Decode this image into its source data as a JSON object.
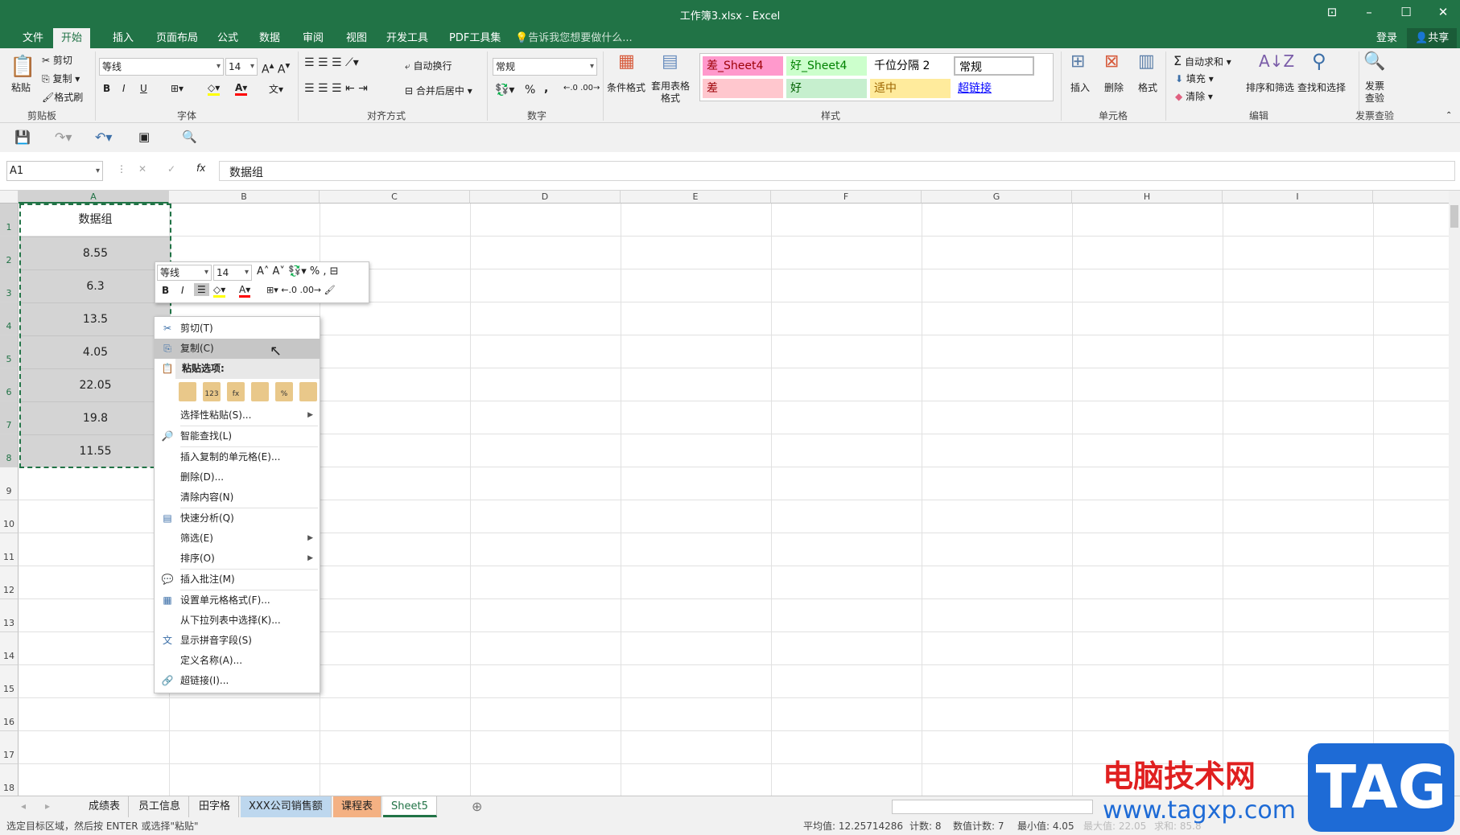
{
  "window": {
    "title": "工作簿3.xlsx - Excel",
    "restore_icon": "ribbon-display-icon"
  },
  "tabs": [
    "文件",
    "开始",
    "插入",
    "页面布局",
    "公式",
    "数据",
    "审阅",
    "视图",
    "开发工具",
    "PDF工具集"
  ],
  "active_tab": "开始",
  "tell_me": "告诉我您想要做什么...",
  "account": {
    "signin": "登录",
    "share": "共享"
  },
  "ribbon": {
    "clipboard": {
      "paste": "粘贴",
      "cut": "剪切",
      "copy": "复制",
      "format_painter": "格式刷",
      "group": "剪贴板"
    },
    "font": {
      "name": "等线",
      "size": "14",
      "bold": "B",
      "italic": "I",
      "underline": "U",
      "group": "字体"
    },
    "alignment": {
      "wrap": "自动换行",
      "merge": "合并后居中",
      "group": "对齐方式"
    },
    "number": {
      "format": "常规",
      "percent": "%",
      "comma": ",",
      "group": "数字"
    },
    "styles": {
      "cond": "条件格式",
      "table": "套用表格格式",
      "cells": [
        {
          "label": "差_Sheet4",
          "bg": "#ff99cc",
          "fg": "#9c0006"
        },
        {
          "label": "好_Sheet4",
          "bg": "#ccffcc",
          "fg": "#008000"
        },
        {
          "label": "千位分隔 2",
          "bg": "#ffffff",
          "fg": "#000000"
        },
        {
          "label": "常规",
          "bg": "#ffffff",
          "fg": "#000000"
        },
        {
          "label": "差",
          "bg": "#ffc7ce",
          "fg": "#9c0006"
        },
        {
          "label": "好",
          "bg": "#c6efce",
          "fg": "#006100"
        },
        {
          "label": "适中",
          "bg": "#ffeb9c",
          "fg": "#9c6500"
        },
        {
          "label": "超链接",
          "bg": "#ffffff",
          "fg": "#0000ff"
        }
      ],
      "group": "样式"
    },
    "cells": {
      "insert": "插入",
      "delete": "删除",
      "format": "格式",
      "group": "单元格"
    },
    "editing": {
      "autosum": "自动求和",
      "fill": "填充",
      "clear": "清除",
      "sort": "排序和筛选",
      "find": "查找和选择",
      "group": "编辑"
    },
    "invoice": {
      "check": "发票查验",
      "group": "发票查验"
    }
  },
  "formula_bar": {
    "name_box": "A1",
    "fx": "fx",
    "content": "数据组"
  },
  "columns": [
    "A",
    "B",
    "C",
    "D",
    "E",
    "F",
    "G",
    "H",
    "I"
  ],
  "rows": [
    "1",
    "2",
    "3",
    "4",
    "5",
    "6",
    "7",
    "8",
    "9",
    "10",
    "11",
    "12",
    "13",
    "14",
    "15",
    "16",
    "17",
    "18"
  ],
  "column_a": [
    "数据组",
    "8.55",
    "6.3",
    "13.5",
    "4.05",
    "22.05",
    "19.8",
    "11.55"
  ],
  "mini_toolbar": {
    "font": "等线",
    "size": "14"
  },
  "context_menu": [
    {
      "label": "剪切(T)",
      "icon": "scissors-icon"
    },
    {
      "label": "复制(C)",
      "icon": "copy-icon",
      "highlight": true
    },
    {
      "label": "粘贴选项:",
      "icon": "paste-icon",
      "header": true
    },
    {
      "label": "选择性粘贴(S)...",
      "submenu": true,
      "sep": true
    },
    {
      "label": "智能查找(L)",
      "icon": "smart-lookup-icon",
      "sep": true
    },
    {
      "label": "插入复制的单元格(E)..."
    },
    {
      "label": "删除(D)..."
    },
    {
      "label": "清除内容(N)",
      "sep": true
    },
    {
      "label": "快速分析(Q)",
      "icon": "quick-analysis-icon"
    },
    {
      "label": "筛选(E)",
      "submenu": true
    },
    {
      "label": "排序(O)",
      "submenu": true,
      "sep": true
    },
    {
      "label": "插入批注(M)",
      "icon": "comment-icon",
      "sep": true
    },
    {
      "label": "设置单元格格式(F)...",
      "icon": "format-cells-icon"
    },
    {
      "label": "从下拉列表中选择(K)..."
    },
    {
      "label": "显示拼音字段(S)",
      "icon": "phonetic-icon"
    },
    {
      "label": "定义名称(A)..."
    },
    {
      "label": "超链接(I)...",
      "icon": "hyperlink-icon"
    }
  ],
  "paste_options": [
    "",
    "123",
    "fx",
    "",
    "%",
    ""
  ],
  "sheets": [
    {
      "name": "成绩表"
    },
    {
      "name": "员工信息"
    },
    {
      "name": "田字格"
    },
    {
      "name": "XXX公司销售额",
      "bg": "#bdd7ee"
    },
    {
      "name": "课程表",
      "bg": "#f4b183"
    },
    {
      "name": "Sheet5",
      "active": true
    }
  ],
  "status": {
    "message": "选定目标区域，然后按 ENTER 或选择\"粘贴\"",
    "average": "平均值: 12.25714286",
    "count": "计数: 8",
    "numeric_count": "数值计数: 7",
    "min": "最小值: 4.05",
    "max": "最大值: 22.05",
    "sum": "求和: 85.8"
  },
  "watermark": {
    "site": "电脑技术网",
    "url": "www.tagxp.com",
    "logo": "TAG"
  }
}
